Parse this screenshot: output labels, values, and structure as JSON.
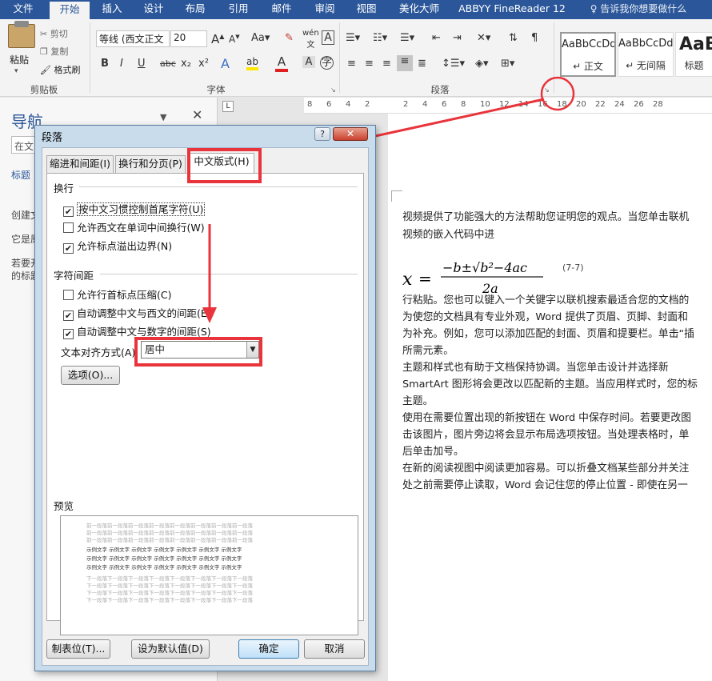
{
  "tabs": [
    "文件",
    "开始",
    "插入",
    "设计",
    "布局",
    "引用",
    "邮件",
    "审阅",
    "视图",
    "美化大师",
    "ABBYY FineReader 12",
    "告诉我你想要做什么"
  ],
  "ribbon": {
    "paste": "粘贴",
    "cut": "剪切",
    "copy": "复制",
    "format_painter": "格式刷",
    "clipboard_group": "剪贴板",
    "font_name": "等线 (西文正文",
    "font_size": "20",
    "font_group": "字体",
    "paragraph_group": "段落",
    "styles": [
      {
        "preview": "AaBbCcDd",
        "name": "↵ 正文"
      },
      {
        "preview": "AaBbCcDd",
        "name": "↵ 无间隔"
      },
      {
        "preview": "AaB",
        "name": "标题"
      }
    ],
    "font_icons": [
      "B",
      "I",
      "U",
      "abc",
      "x₂",
      "x²"
    ]
  },
  "ruler_numbers": [
    "8",
    "6",
    "4",
    "2",
    "",
    "2",
    "4",
    "6",
    "8",
    "10",
    "12",
    "14",
    "16",
    "18",
    "20",
    "22",
    "24",
    "26",
    "28"
  ],
  "nav": {
    "title": "导航",
    "search": "在文",
    "items": [
      "标题",
      "创建文",
      "它是原",
      "若要开",
      "的标题"
    ]
  },
  "doc": {
    "lines": [
      "视频提供了功能强大的方法帮助您证明您的观点。当您单击联机",
      "视频的嵌入代码中进",
      "行粘贴。您也可以键入一个关键字以联机搜索最适合您的文档的",
      "为使您的文档具有专业外观，Word 提供了页眉、页脚、封面和",
      "为补充。例如，您可以添加匹配的封面、页眉和提要栏。单击“插",
      "所需元素。",
      "主题和样式也有助于文档保持协调。当您单击设计并选择新",
      "SmartArt 图形将会更改以匹配新的主题。当应用样式时，您的标",
      "主题。",
      "使用在需要位置出现的新按钮在 Word 中保存时间。若要更改图",
      "击该图片，图片旁边将会显示布局选项按钮。当处理表格时，单",
      "后单击加号。",
      "在新的阅读视图中阅读更加容易。可以折叠文档某些部分并关注",
      "处之前需要停止读取，Word 会记住您的停止位置 - 即使在另一"
    ],
    "eq_label": "(7-7)"
  },
  "dialog": {
    "title": "段落",
    "tabs": [
      "缩进和间距(I)",
      "换行和分页(P)",
      "中文版式(H)"
    ],
    "sections": {
      "wrap": "换行",
      "spacing": "字符间距",
      "preview": "预览"
    },
    "wrap_options": [
      {
        "label": "按中文习惯控制首尾字符(U)",
        "checked": true
      },
      {
        "label": "允许西文在单词中间换行(W)",
        "checked": false
      },
      {
        "label": "允许标点溢出边界(N)",
        "checked": true
      }
    ],
    "spacing_options": [
      {
        "label": "允许行首标点压缩(C)",
        "checked": false
      },
      {
        "label": "自动调整中文与西文的间距(E)",
        "checked": true
      },
      {
        "label": "自动调整中文与数字的间距(S)",
        "checked": true
      }
    ],
    "align_label": "文本对齐方式(A):",
    "align_value": "居中",
    "options_btn": "选项(O)...",
    "preview_prev": "前一段落前一段落前一段落前一段落前一段落前一段落前一段落前一段落",
    "preview_sample": "示例文字 示例文字 示例文字 示例文字 示例文字 示例文字 示例文字",
    "preview_next": "下一段落下一段落下一段落下一段落下一段落下一段落下一段落下一段落",
    "buttons": {
      "tabs": "制表位(T)...",
      "default": "设为默认值(D)",
      "ok": "确定",
      "cancel": "取消"
    }
  },
  "colors": {
    "accent": "#2b579a",
    "annotation": "#e8343a"
  }
}
